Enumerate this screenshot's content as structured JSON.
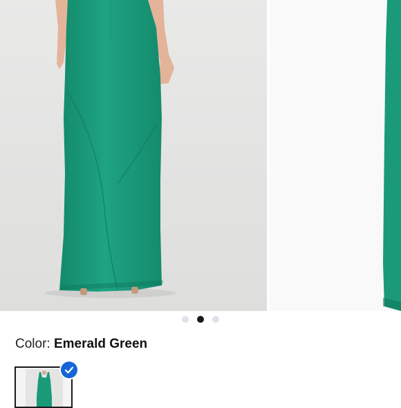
{
  "gallery": {
    "slide_count": 3,
    "active_slide": 2,
    "images": [
      {
        "icon": "emerald-green-maxi-dress-back-view"
      },
      {
        "icon": "emerald-green-dress-partial-view"
      }
    ]
  },
  "color": {
    "label": "Color:",
    "value": "Emerald Green",
    "hex": "#1a9a78"
  },
  "swatches": [
    {
      "name": "Emerald Green",
      "selected": true
    }
  ],
  "theme": {
    "selected_accent": "#1565d8",
    "active_dot": "#1a1a1a",
    "inactive_dot": "#dde3ea"
  }
}
